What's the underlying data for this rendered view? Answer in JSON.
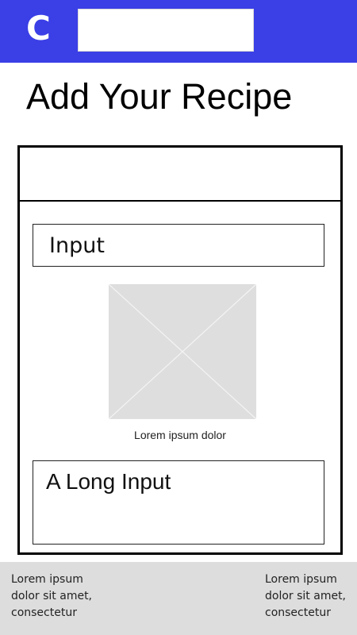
{
  "header": {
    "logo_text": "C",
    "background_color": "#3a3fe6",
    "search_value": ""
  },
  "main": {
    "title": "Add Your Recipe"
  },
  "form": {
    "input_label": "Input",
    "image_icon": "image-placeholder-icon",
    "image_caption": "Lorem ipsum dolor",
    "long_input_label": "A Long Input"
  },
  "footer": {
    "left_text": "Lorem ipsum dolor sit amet, consectetur",
    "right_text": "Lorem ipsum dolor sit amet, consectetur",
    "background_color": "#dddddd"
  }
}
